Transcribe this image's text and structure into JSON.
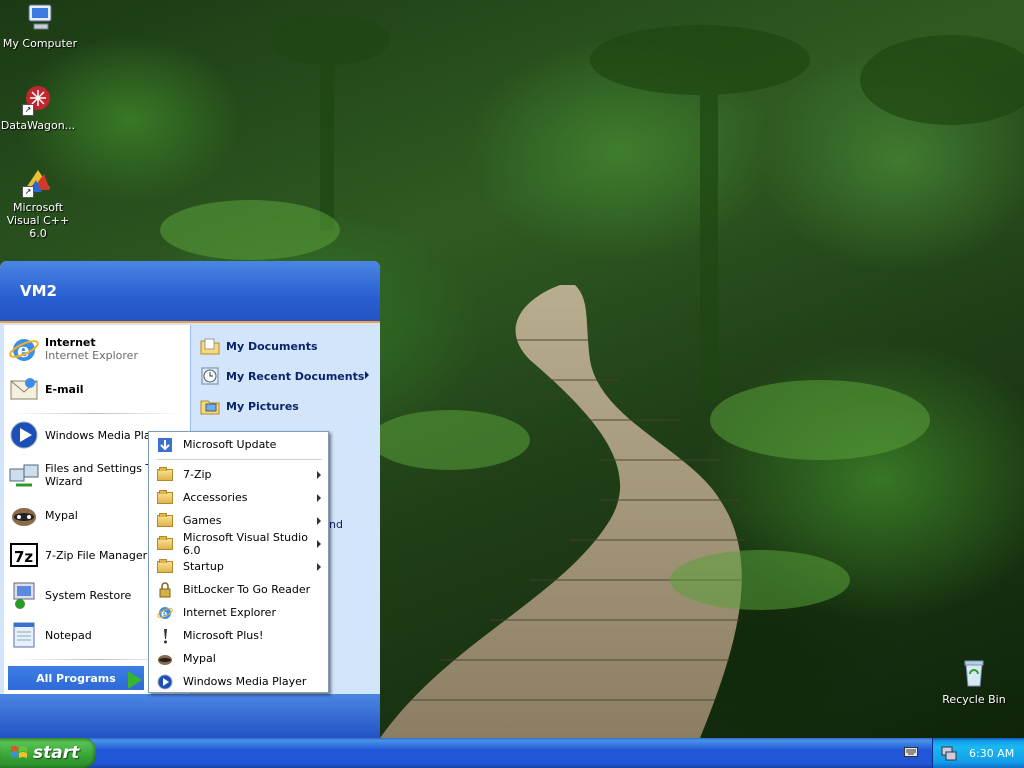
{
  "desktop": {
    "icons": [
      {
        "label": "My Computer",
        "icon": "my-computer-icon"
      },
      {
        "label": "DataWagon...",
        "icon": "datawagon-icon"
      },
      {
        "label": "Microsoft Visual C++ 6.0",
        "icon": "visual-cpp-icon"
      },
      {
        "label": "Recycle Bin",
        "icon": "recycle-bin-icon"
      }
    ]
  },
  "start_menu": {
    "user": "VM2",
    "pinned": [
      {
        "title": "Internet",
        "subtitle": "Internet Explorer"
      },
      {
        "title": "E-mail"
      }
    ],
    "recent": [
      "Windows Media Player",
      "Files and Settings Transfer Wizard",
      "Mypal",
      "7-Zip File Manager",
      "System Restore",
      "Notepad"
    ],
    "recent_display": {
      "wmp": "Windows Media Playe",
      "fst_line1": "Files and Settings Tra",
      "fst_line2": "Wizard"
    },
    "all_programs": "All Programs",
    "right": [
      {
        "label": "My Documents",
        "has_submenu": false
      },
      {
        "label": "My Recent Documents",
        "has_submenu": true
      },
      {
        "label": "My Pictures",
        "has_submenu": false
      }
    ],
    "right_clipped": "nd"
  },
  "programs_menu": {
    "items": [
      {
        "label": "Microsoft Update",
        "icon": "windows-update-icon",
        "submenu": false
      },
      {
        "label": "7-Zip",
        "icon": "folder-icon",
        "submenu": true
      },
      {
        "label": "Accessories",
        "icon": "folder-icon",
        "submenu": true
      },
      {
        "label": "Games",
        "icon": "folder-icon",
        "submenu": true
      },
      {
        "label": "Microsoft Visual Studio 6.0",
        "icon": "folder-icon",
        "submenu": true
      },
      {
        "label": "Startup",
        "icon": "folder-icon",
        "submenu": true
      },
      {
        "label": "BitLocker To Go Reader",
        "icon": "bitlocker-icon",
        "submenu": false
      },
      {
        "label": "Internet Explorer",
        "icon": "ie-icon",
        "submenu": false
      },
      {
        "label": "Microsoft Plus!",
        "icon": "plus-icon",
        "submenu": false
      },
      {
        "label": "Mypal",
        "icon": "mypal-icon",
        "submenu": false
      },
      {
        "label": "Windows Media Player",
        "icon": "media-player-icon",
        "submenu": false
      }
    ]
  },
  "taskbar": {
    "start_label": "start",
    "clock": "6:30 AM"
  },
  "colors": {
    "taskbar_blue": "#2157d7",
    "start_green": "#37a435",
    "menu_header_blue": "#2a5fd1",
    "right_pane": "#d3e5fa"
  }
}
